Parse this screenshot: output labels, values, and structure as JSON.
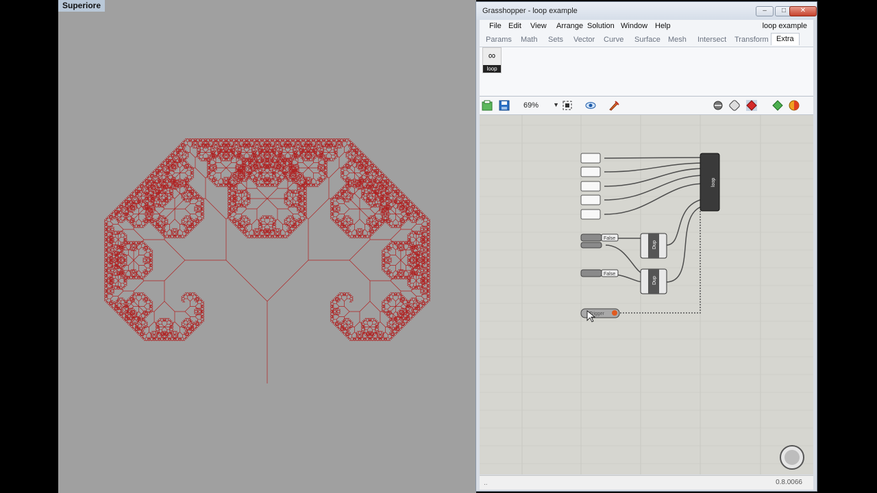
{
  "viewport": {
    "label": "Superiore",
    "fractal_color": "#b02020",
    "background": "#a0a0a0"
  },
  "grasshopper": {
    "title": "Grasshopper - loop example",
    "document_name": "loop example",
    "window_buttons": {
      "minimize": "–",
      "maximize": "□",
      "close": "✕"
    },
    "menu": [
      "File",
      "Edit",
      "View",
      "Arrange",
      "Solution",
      "Window",
      "Help"
    ],
    "tabs": [
      "Params",
      "Math",
      "Sets",
      "Vector",
      "Curve",
      "Surface",
      "Mesh",
      "Intersect",
      "Transform",
      "Extra"
    ],
    "active_tab": "Extra",
    "ribbon": {
      "component_glyph": "∞",
      "component_label": "loop"
    },
    "toolbar": {
      "zoom": "69%",
      "icons": [
        "open-file-icon",
        "save-file-icon",
        "zoom-dropdown",
        "zoom-extents-icon",
        "preview-eye-icon",
        "sketch-pen-icon",
        "wire-display-icon",
        "preview-mode-icon",
        "disable-solver-icon",
        "shaded-preview-icon",
        "color-preview-icon"
      ]
    },
    "canvas": {
      "grid_color": "#c8c8c2",
      "loop_component_label": "loop",
      "false_label_1": "False",
      "false_label_2": "False",
      "dup_label_1": "Dup",
      "dup_label_2": "Dup",
      "trigger_label": "Trigger"
    },
    "status": {
      "left": "..",
      "version": "0.8.0066"
    }
  }
}
